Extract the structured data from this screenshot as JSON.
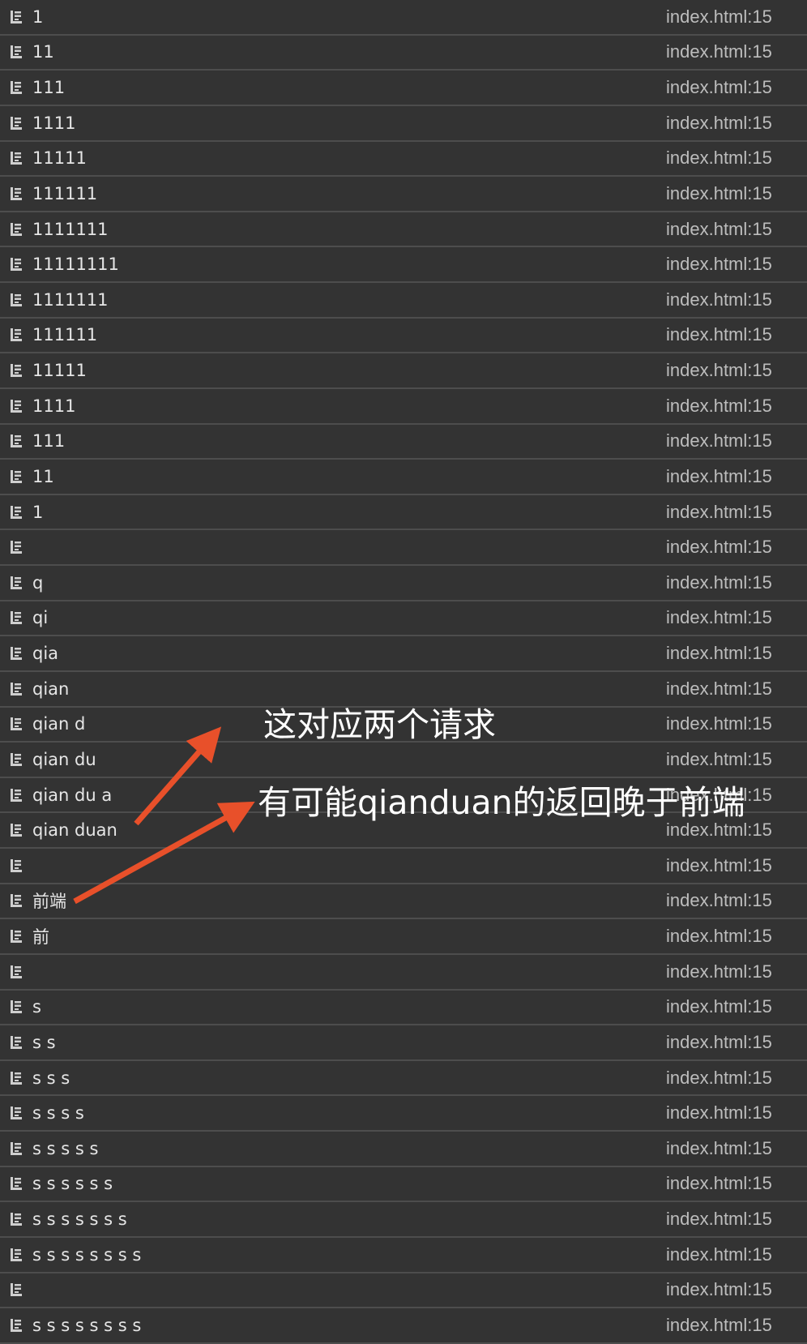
{
  "console": {
    "source_link": "index.html:15",
    "rows": [
      {
        "message": "1"
      },
      {
        "message": "11"
      },
      {
        "message": "111"
      },
      {
        "message": "1111"
      },
      {
        "message": "11111"
      },
      {
        "message": "111111"
      },
      {
        "message": "1111111"
      },
      {
        "message": "11111111"
      },
      {
        "message": "1111111"
      },
      {
        "message": "111111"
      },
      {
        "message": "11111"
      },
      {
        "message": "1111"
      },
      {
        "message": "111"
      },
      {
        "message": "11"
      },
      {
        "message": "1"
      },
      {
        "message": ""
      },
      {
        "message": "q"
      },
      {
        "message": "qi"
      },
      {
        "message": "qia"
      },
      {
        "message": "qian"
      },
      {
        "message": "qian d"
      },
      {
        "message": "qian du"
      },
      {
        "message": "qian du a"
      },
      {
        "message": "qian duan"
      },
      {
        "message": ""
      },
      {
        "message": "前端"
      },
      {
        "message": "前"
      },
      {
        "message": ""
      },
      {
        "message": "s"
      },
      {
        "message": "s s"
      },
      {
        "message": "s s s"
      },
      {
        "message": "s s s s"
      },
      {
        "message": "s s s s s"
      },
      {
        "message": "s s s s s s"
      },
      {
        "message": "s s s s s s s"
      },
      {
        "message": "s s s s s s s s"
      },
      {
        "message": ""
      },
      {
        "message": "s s s s s s s s"
      }
    ]
  },
  "annotations": {
    "note1": "这对应两个请求",
    "note2": "有可能qianduan的返回晚于前端",
    "arrow_color": "#e8502a"
  },
  "icons": {
    "row_icon": "console-log-icon"
  },
  "colors": {
    "background": "#333333",
    "divider": "#4d4d4d",
    "text": "#e6e6e6",
    "source": "#bdbdbd"
  }
}
